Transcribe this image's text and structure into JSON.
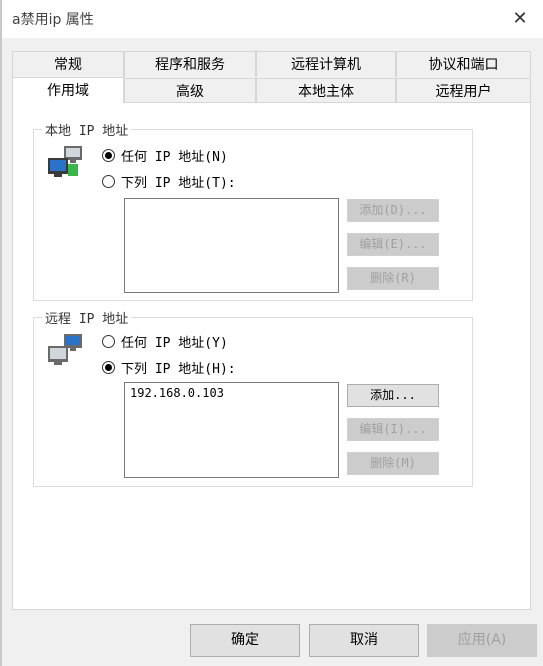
{
  "window": {
    "title": "a禁用ip 属性",
    "close_glyph": "✕"
  },
  "tabs_back": [
    "常规",
    "程序和服务",
    "远程计算机",
    "协议和端口"
  ],
  "tabs_front": [
    "作用域",
    "高级",
    "本地主体",
    "远程用户"
  ],
  "local": {
    "label": "本地 IP 地址",
    "option_any": "任何 IP 地址(N)",
    "option_list": "下列 IP 地址(T):",
    "selected": "any",
    "entries": [],
    "buttons": {
      "add": "添加(D)...",
      "edit": "编辑(E)...",
      "remove": "删除(R)"
    }
  },
  "remote": {
    "label": "远程 IP 地址",
    "option_any": "任何 IP 地址(Y)",
    "option_list": "下列 IP 地址(H):",
    "selected": "list",
    "entries": [
      "192.168.0.103"
    ],
    "buttons": {
      "add": "添加...",
      "edit": "编辑(I)...",
      "remove": "删除(M)"
    }
  },
  "footer": {
    "ok": "确定",
    "cancel": "取消",
    "apply": "应用(A)"
  }
}
